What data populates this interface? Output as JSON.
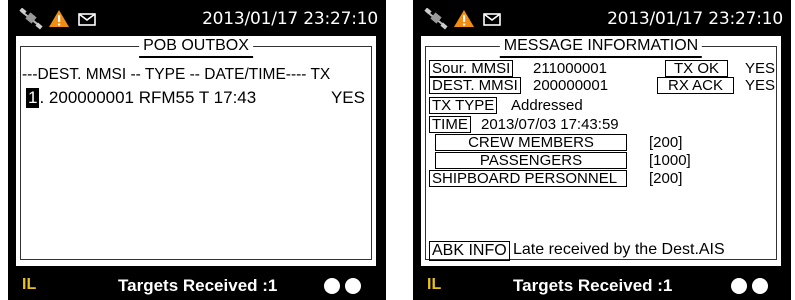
{
  "left": {
    "datetime": "2013/01/17 23:27:10",
    "panel_title": "POB OUTBOX",
    "header": "---DEST. MMSI -- TYPE -- DATE/TIME---- TX",
    "rows": [
      {
        "index": "1",
        "rest": ". 200000001  RFM55  T  17:43",
        "tx": "YES"
      }
    ],
    "il": "IL",
    "targets": "Targets Received :1"
  },
  "right": {
    "datetime": "2013/01/17 23:27:10",
    "panel_title": "MESSAGE INFORMATION",
    "sour_mmsi_label": "Sour.  MMSI",
    "sour_mmsi_value": "211000001",
    "tx_ok_label": "TX  OK",
    "tx_ok_value": "YES",
    "dest_mmsi_label": "DEST.  MMSI",
    "dest_mmsi_value": "200000001",
    "rx_ack_label": "RX  ACK",
    "rx_ack_value": "YES",
    "tx_type_label": "TX  TYPE",
    "tx_type_value": "Addressed",
    "time_label": "TIME",
    "time_value": "2013/07/03 17:43:59",
    "crew_label": "CREW MEMBERS",
    "crew_value": "[200]",
    "pass_label": "PASSENGERS",
    "pass_value": "[1000]",
    "ship_label": "SHIPBOARD PERSONNEL",
    "ship_value": "[200]",
    "abk_label": "ABK INFO",
    "abk_value": "Late  received  by  the  Dest.AIS",
    "il": "IL",
    "targets": "Targets Received :1"
  },
  "colors": {
    "background": "#000000",
    "panel": "#ffffff",
    "warning": "#f28c12",
    "il": "#e7c21c"
  },
  "icons": [
    "satellite-icon",
    "warning-icon",
    "mail-icon"
  ]
}
